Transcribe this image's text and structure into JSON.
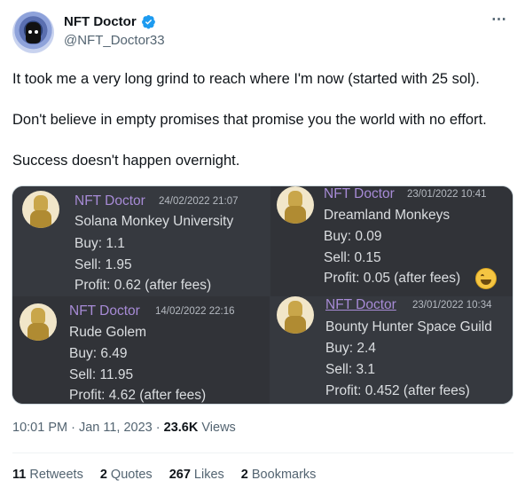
{
  "author": {
    "display_name": "NFT Doctor",
    "handle": "@NFT_Doctor33"
  },
  "more_icon": "⋯",
  "tweet": {
    "paragraphs": [
      "It took me a very long grind to reach where I'm now (started with 25 sol).",
      "Don't believe in empty promises that promise you the world with no effort.",
      "Success doesn't happen overnight."
    ]
  },
  "media": {
    "posts": [
      {
        "author": "NFT Doctor",
        "timestamp": "24/02/2022 21:07",
        "project": "Solana Monkey University",
        "buy": "Buy: 1.1",
        "sell": "Sell: 1.95",
        "profit": "Profit: 0.62 (after fees)"
      },
      {
        "author": "NFT Doctor",
        "timestamp": "23/01/2022 10:41",
        "project": "Dreamland Monkeys",
        "buy": "Buy: 0.09",
        "sell": "Sell: 0.15",
        "profit": "Profit: 0.05 (after fees)",
        "emoji": "grinning-face-with-smiling-eyes"
      },
      {
        "author": "NFT Doctor",
        "timestamp": "14/02/2022 22:16",
        "project": "Rude Golem",
        "buy": "Buy: 6.49",
        "sell": "Sell: 11.95",
        "profit": "Profit: 4.62 (after fees)"
      },
      {
        "author": "NFT Doctor",
        "timestamp": "23/01/2022 10:34",
        "project": "Bounty Hunter Space Guild",
        "buy": "Buy: 2.4",
        "sell": "Sell: 3.1",
        "profit": "Profit: 0.452 (after fees)"
      }
    ]
  },
  "meta": {
    "time": "10:01 PM",
    "sep1": " · ",
    "date": "Jan 11, 2023",
    "sep2": " · ",
    "views_count": "23.6K",
    "views_label": " Views"
  },
  "stats": {
    "retweets_count": "11",
    "retweets_label": " Retweets",
    "quotes_count": "2",
    "quotes_label": " Quotes",
    "likes_count": "267",
    "likes_label": " Likes",
    "bookmarks_count": "2",
    "bookmarks_label": " Bookmarks"
  },
  "colors": {
    "verified": "#1d9bf0",
    "discord_name": "#a78bd6",
    "discord_bg": "#36393f"
  }
}
